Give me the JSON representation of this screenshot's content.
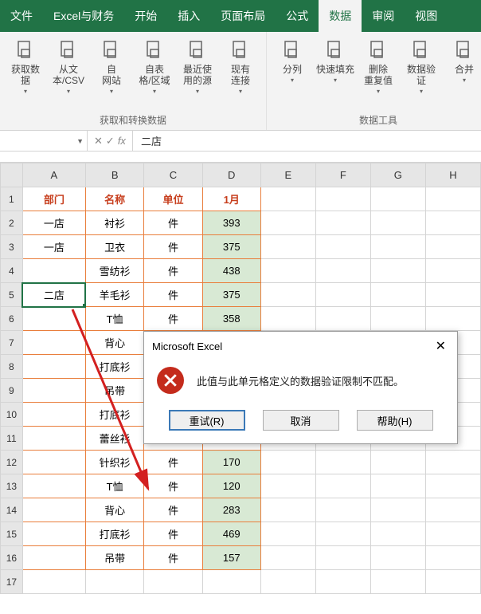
{
  "tabs": [
    "文件",
    "Excel与财务",
    "开始",
    "插入",
    "页面布局",
    "公式",
    "数据",
    "审阅",
    "视图"
  ],
  "active_tab_index": 6,
  "ribbon": {
    "group1_label": "获取和转换数据",
    "btns1": [
      "获取数\n据",
      "从文\n本/CSV",
      "自\n网站",
      "自表\n格/区域",
      "最近使\n用的源",
      "现有\n连接"
    ],
    "group2_label": "数据工具",
    "btns2": [
      "分列",
      "快速填充",
      "删除\n重复值",
      "数据验\n证",
      "合并"
    ]
  },
  "namebox": "",
  "formula": "二店",
  "columns": [
    "A",
    "B",
    "C",
    "D",
    "E",
    "F",
    "G",
    "H"
  ],
  "rows": [
    {
      "n": 1,
      "a": "部门",
      "b": "名称",
      "c": "单位",
      "d": "1月"
    },
    {
      "n": 2,
      "a": "一店",
      "b": "衬衫",
      "c": "件",
      "d": "393"
    },
    {
      "n": 3,
      "a": "一店",
      "b": "卫衣",
      "c": "件",
      "d": "375"
    },
    {
      "n": 4,
      "a": "",
      "b": "雪纺衫",
      "c": "件",
      "d": "438"
    },
    {
      "n": 5,
      "a": "二店",
      "b": "羊毛衫",
      "c": "件",
      "d": "375"
    },
    {
      "n": 6,
      "a": "",
      "b": "T恤",
      "c": "件",
      "d": "358"
    },
    {
      "n": 7,
      "a": "",
      "b": "背心",
      "c": "",
      "d": ""
    },
    {
      "n": 8,
      "a": "",
      "b": "打底衫",
      "c": "",
      "d": ""
    },
    {
      "n": 9,
      "a": "",
      "b": "吊带",
      "c": "",
      "d": ""
    },
    {
      "n": 10,
      "a": "",
      "b": "打底衫",
      "c": "",
      "d": ""
    },
    {
      "n": 11,
      "a": "",
      "b": "蕾丝衫",
      "c": "",
      "d": ""
    },
    {
      "n": 12,
      "a": "",
      "b": "针织衫",
      "c": "件",
      "d": "170"
    },
    {
      "n": 13,
      "a": "",
      "b": "T恤",
      "c": "件",
      "d": "120"
    },
    {
      "n": 14,
      "a": "",
      "b": "背心",
      "c": "件",
      "d": "283"
    },
    {
      "n": 15,
      "a": "",
      "b": "打底衫",
      "c": "件",
      "d": "469"
    },
    {
      "n": 16,
      "a": "",
      "b": "吊带",
      "c": "件",
      "d": "157"
    },
    {
      "n": 17,
      "a": "",
      "b": "",
      "c": "",
      "d": ""
    }
  ],
  "dialog": {
    "title": "Microsoft Excel",
    "message": "此值与此单元格定义的数据验证限制不匹配。",
    "retry": "重试(R)",
    "cancel": "取消",
    "help": "帮助(H)"
  }
}
